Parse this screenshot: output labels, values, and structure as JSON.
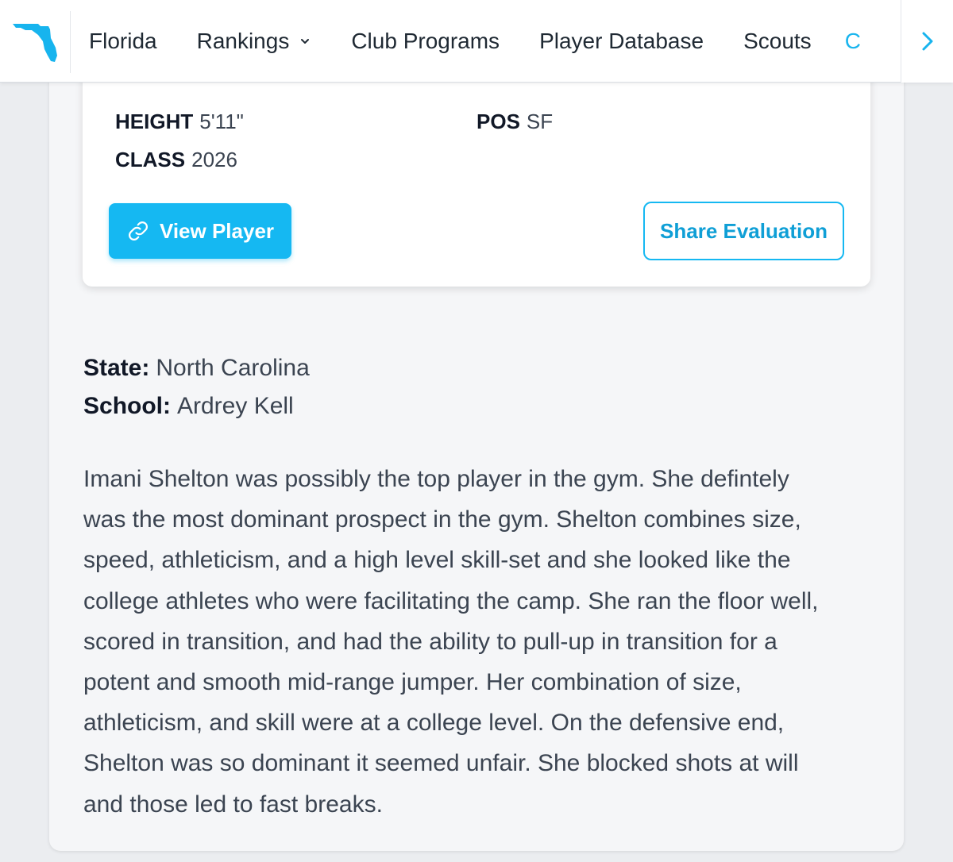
{
  "nav": {
    "items": [
      {
        "label": "Florida",
        "has_dropdown": false
      },
      {
        "label": "Rankings",
        "has_dropdown": true
      },
      {
        "label": "Club Programs",
        "has_dropdown": false
      },
      {
        "label": "Player Database",
        "has_dropdown": false
      },
      {
        "label": "Scouts",
        "has_dropdown": false
      }
    ],
    "overflow_partial_text": "C",
    "logo_icon": "florida-state-icon",
    "next_icon": "chevron-right-icon"
  },
  "player_card": {
    "height_label": "HEIGHT",
    "height_value": "5'11\"",
    "pos_label": "POS",
    "pos_value": "SF",
    "class_label": "CLASS",
    "class_value": "2026",
    "view_button_label": "View Player",
    "view_button_icon": "link-icon",
    "share_button_label": "Share Evaluation"
  },
  "details": {
    "state_label": "State:",
    "state_value": "North Carolina",
    "school_label": "School:",
    "school_value": "Ardrey Kell"
  },
  "evaluation_lines": [
    "Imani Shelton was possibly the top player in the gym. She defintely",
    "was the most dominant prospect in the gym. Shelton combines size,",
    "speed, athleticism, and a high level skill-set and she looked like the",
    "college athletes who were facilitating the camp. She ran the floor well,",
    "scored in transition, and had the ability to pull-up in transition for a",
    "potent and smooth mid-range jumper. Her combination of size,",
    "athleticism, and skill were at a college level. On the defensive end,",
    "Shelton was so dominant it seemed unfair. She blocked shots at will",
    "and those led to fast breaks."
  ],
  "colors": {
    "accent": "#15b8f2",
    "page_bg": "#ebedf0",
    "panel_bg": "#f5f6f8",
    "text": "#3b4451"
  }
}
